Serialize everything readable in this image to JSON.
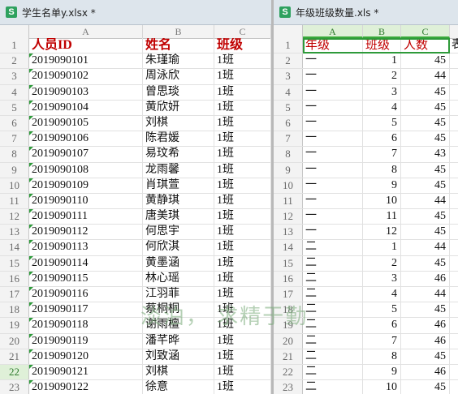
{
  "left": {
    "title": "学生名单y.xlsx *",
    "icon": "S",
    "columns": [
      "A",
      "B",
      "C"
    ],
    "selected_row": 22,
    "header": [
      "人员ID",
      "姓名",
      "班级"
    ],
    "rows": [
      [
        "2019090101",
        "朱瑾瑜",
        "1班"
      ],
      [
        "2019090102",
        "周泳欣",
        "1班"
      ],
      [
        "2019090103",
        "曾思琰",
        "1班"
      ],
      [
        "2019090104",
        "黄欣妍",
        "1班"
      ],
      [
        "2019090105",
        "刘棋",
        "1班"
      ],
      [
        "2019090106",
        "陈君媛",
        "1班"
      ],
      [
        "2019090107",
        "易玟希",
        "1班"
      ],
      [
        "2019090108",
        "龙雨馨",
        "1班"
      ],
      [
        "2019090109",
        "肖琪萱",
        "1班"
      ],
      [
        "2019090110",
        "黄静琪",
        "1班"
      ],
      [
        "2019090111",
        "唐美琪",
        "1班"
      ],
      [
        "2019090112",
        "何思宇",
        "1班"
      ],
      [
        "2019090113",
        "何欣淇",
        "1班"
      ],
      [
        "2019090114",
        "黄墨涵",
        "1班"
      ],
      [
        "2019090115",
        "林心瑶",
        "1班"
      ],
      [
        "2019090116",
        "江羽菲",
        "1班"
      ],
      [
        "2019090117",
        "蔡桐桐",
        "1班"
      ],
      [
        "2019090118",
        "谢雨檀",
        "1班"
      ],
      [
        "2019090119",
        "潘芊晔",
        "1班"
      ],
      [
        "2019090120",
        "刘致涵",
        "1班"
      ],
      [
        "2019090121",
        "刘棋",
        "1班"
      ],
      [
        "2019090122",
        "徐意",
        "1班"
      ]
    ]
  },
  "right": {
    "title": "年级班级数量.xls *",
    "icon": "S",
    "columns": [
      "A",
      "B",
      "C"
    ],
    "header": [
      "年级",
      "班级",
      "人数"
    ],
    "overflow_cell": "表",
    "rows": [
      [
        "一",
        "1",
        "45"
      ],
      [
        "一",
        "2",
        "44"
      ],
      [
        "一",
        "3",
        "45"
      ],
      [
        "一",
        "4",
        "45"
      ],
      [
        "一",
        "5",
        "45"
      ],
      [
        "一",
        "6",
        "45"
      ],
      [
        "一",
        "7",
        "43"
      ],
      [
        "一",
        "8",
        "45"
      ],
      [
        "一",
        "9",
        "45"
      ],
      [
        "一",
        "10",
        "44"
      ],
      [
        "一",
        "11",
        "45"
      ],
      [
        "一",
        "12",
        "45"
      ],
      [
        "二",
        "1",
        "44"
      ],
      [
        "二",
        "2",
        "45"
      ],
      [
        "二",
        "3",
        "46"
      ],
      [
        "二",
        "4",
        "44"
      ],
      [
        "二",
        "5",
        "45"
      ],
      [
        "二",
        "6",
        "46"
      ],
      [
        "二",
        "7",
        "46"
      ],
      [
        "二",
        "8",
        "45"
      ],
      [
        "二",
        "9",
        "46"
      ],
      [
        "二",
        "10",
        "45"
      ]
    ]
  },
  "watermark": "淡泊， 求精于勤",
  "colors": {
    "accent": "#2e9a3a",
    "header_text": "#c00000",
    "icon_bg": "#2ea15f"
  }
}
